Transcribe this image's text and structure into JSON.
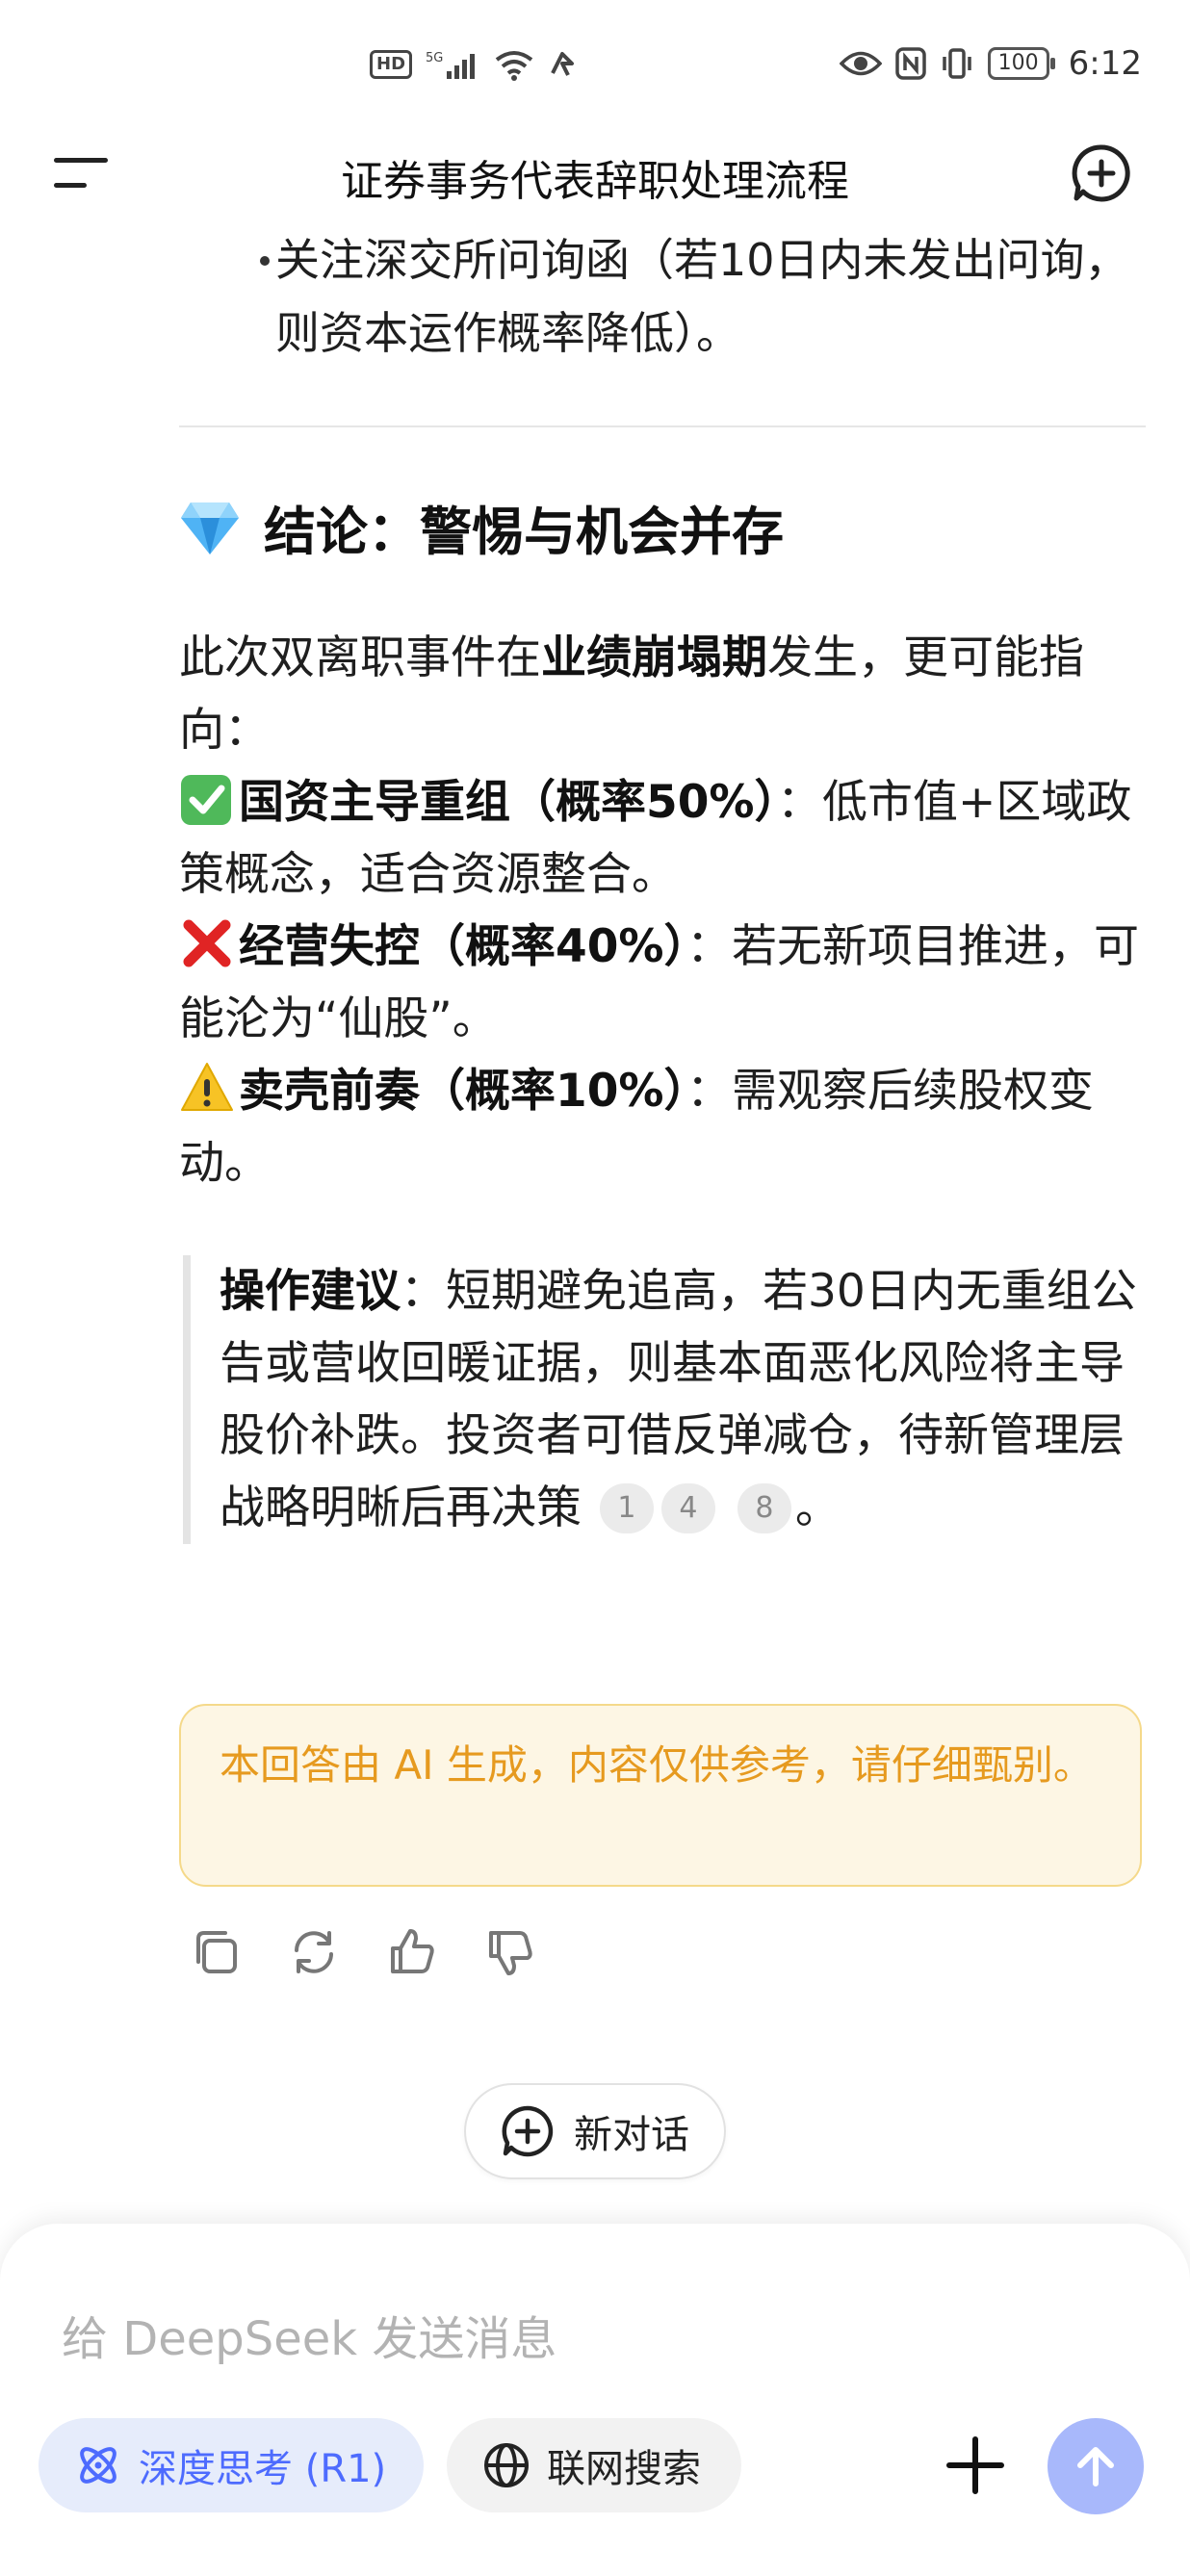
{
  "status_bar": {
    "hd": "HD",
    "signal": "5G",
    "battery": "100",
    "time": "6:12"
  },
  "header": {
    "title": "证券事务代表辞职处理流程"
  },
  "content": {
    "bullet_text": "关注深交所问询函（若10日内未发出问询，则资本运作概率降低）。",
    "section_title": "结论：警惕与机会并存",
    "intro_prefix": "此次双离职事件在",
    "intro_bold": "业绩崩塌期",
    "intro_suffix": "发生，更可能指向：",
    "items": [
      {
        "bold": "国资主导重组（概率50%）",
        "text": "：低市值+区域政策概念，适合资源整合。"
      },
      {
        "bold": "经营失控（概率40%）",
        "text": "：若无新项目推进，可能沦为“仙股”。"
      },
      {
        "bold": "卖壳前奏（概率10%）",
        "text": "：需观察后续股权变动。"
      }
    ],
    "quote_bold": "操作建议",
    "quote_text": "：短期避免追高，若30日内无重组公告或营收回暖证据，则基本面恶化风险将主导股价补跌。投资者可借反弹减仓，待新管理层战略明晰后再决策",
    "citations": [
      "1",
      "4",
      "8"
    ],
    "quote_end": "。",
    "notice": "本回答由 AI 生成，内容仅供参考，请仔细甄别。"
  },
  "actions": [
    "copy-icon",
    "refresh-icon",
    "thumbs-up-icon",
    "thumbs-down-icon"
  ],
  "new_dialog_label": "新对话",
  "composer": {
    "placeholder": "给 DeepSeek 发送消息",
    "deep_think_label": "深度思考 (R1)",
    "web_search_label": "联网搜索"
  },
  "colors": {
    "accent": "#4d6bfe",
    "notice_text": "#e69a1f",
    "notice_bg": "#fdf6e4",
    "send_btn": "#a8b8fb"
  }
}
